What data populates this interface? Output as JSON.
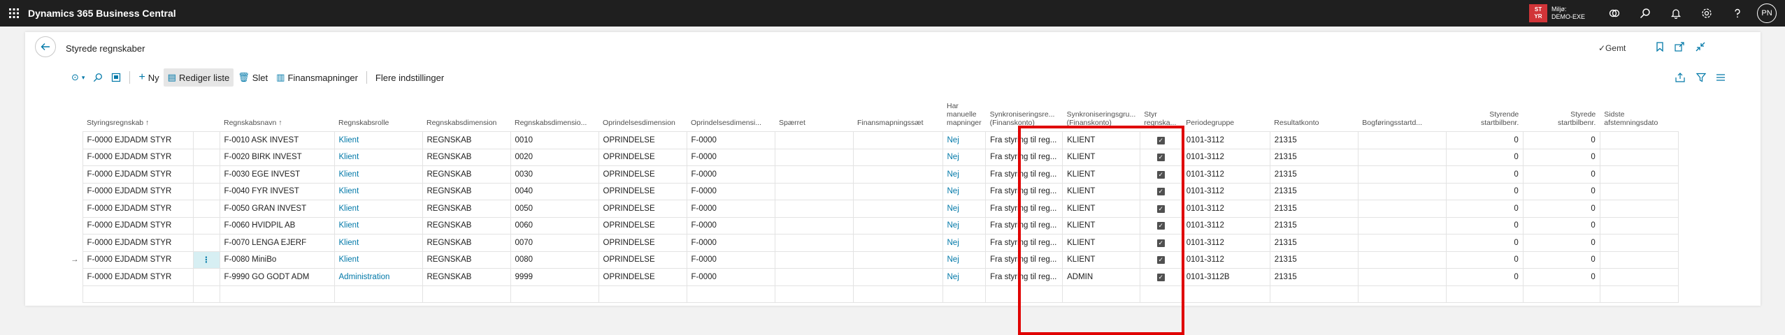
{
  "topbar": {
    "app_name": "Dynamics 365 Business Central",
    "env_badge_line1": "ST",
    "env_badge_line2": "YR",
    "env_line1": "Miljø:",
    "env_line2": "DEMO-EXE",
    "avatar": "PN",
    "icons": [
      "waffle-icon",
      "connect-icon",
      "search-icon",
      "bell-icon",
      "settings-icon",
      "help-icon"
    ]
  },
  "page": {
    "title": "Styrede regnskaber",
    "saved": "✓Gemt"
  },
  "actions": {
    "new": "Ny",
    "edit_list": "Rediger liste",
    "delete": "Slet",
    "mapping": "Finansmapninger",
    "more": "Flere indstillinger"
  },
  "columns": [
    {
      "l1": "",
      "l2": "Styringsregnskab ↑"
    },
    {
      "l1": "",
      "l2": ""
    },
    {
      "l1": "",
      "l2": "Regnskabsnavn ↑"
    },
    {
      "l1": "",
      "l2": "Regnskabsrolle"
    },
    {
      "l1": "",
      "l2": "Regnskabsdimension"
    },
    {
      "l1": "",
      "l2": "Regnskabsdimensio..."
    },
    {
      "l1": "",
      "l2": "Oprindelsesdimension"
    },
    {
      "l1": "",
      "l2": "Oprindelsesdimensi..."
    },
    {
      "l1": "",
      "l2": "Spærret"
    },
    {
      "l1": "",
      "l2": "Finansmapningssæt"
    },
    {
      "l1": "Har",
      "l2": "manuelle",
      "l3": "mapninger"
    },
    {
      "l1": "Synkroniseringsre...",
      "l2": "(Finanskonto)"
    },
    {
      "l1": "Synkroniseringsgru...",
      "l2": "(Finanskonto)"
    },
    {
      "l1": "Styr",
      "l2": "regnska..."
    },
    {
      "l1": "",
      "l2": "Periodegruppe"
    },
    {
      "l1": "",
      "l2": "Resultatkonto"
    },
    {
      "l1": "",
      "l2": "Bogføringsstartd..."
    },
    {
      "l1": "Styrende",
      "l2": "startbilbenr."
    },
    {
      "l1": "Styrede",
      "l2": "startbilbenr."
    },
    {
      "l1": "Sidste",
      "l2": "afstemningsdato"
    }
  ],
  "rows": [
    {
      "arrow": "",
      "account": "F-0000 EJDADM STYR",
      "dots": "",
      "name": "F-0010 ASK INVEST",
      "role": "Klient",
      "dim": "REGNSKAB",
      "dimval": "0010",
      "origdim": "OPRINDELSE",
      "origval": "F-0000",
      "blocked": "",
      "mapset": "",
      "manual": "Nej",
      "syncdir": "Fra styring til reg...",
      "syncgrp": "KLIENT",
      "period": "0101-3112",
      "result": "21315",
      "poststart": "",
      "ctrl_start": "0",
      "sub_start": "0",
      "last_rec": ""
    },
    {
      "arrow": "",
      "account": "F-0000 EJDADM STYR",
      "dots": "",
      "name": "F-0020 BIRK INVEST",
      "role": "Klient",
      "dim": "REGNSKAB",
      "dimval": "0020",
      "origdim": "OPRINDELSE",
      "origval": "F-0000",
      "blocked": "",
      "mapset": "",
      "manual": "Nej",
      "syncdir": "Fra styring til reg...",
      "syncgrp": "KLIENT",
      "period": "0101-3112",
      "result": "21315",
      "poststart": "",
      "ctrl_start": "0",
      "sub_start": "0",
      "last_rec": ""
    },
    {
      "arrow": "",
      "account": "F-0000 EJDADM STYR",
      "dots": "",
      "name": "F-0030 EGE INVEST",
      "role": "Klient",
      "dim": "REGNSKAB",
      "dimval": "0030",
      "origdim": "OPRINDELSE",
      "origval": "F-0000",
      "blocked": "",
      "mapset": "",
      "manual": "Nej",
      "syncdir": "Fra styring til reg...",
      "syncgrp": "KLIENT",
      "period": "0101-3112",
      "result": "21315",
      "poststart": "",
      "ctrl_start": "0",
      "sub_start": "0",
      "last_rec": ""
    },
    {
      "arrow": "",
      "account": "F-0000 EJDADM STYR",
      "dots": "",
      "name": "F-0040 FYR INVEST",
      "role": "Klient",
      "dim": "REGNSKAB",
      "dimval": "0040",
      "origdim": "OPRINDELSE",
      "origval": "F-0000",
      "blocked": "",
      "mapset": "",
      "manual": "Nej",
      "syncdir": "Fra styring til reg...",
      "syncgrp": "KLIENT",
      "period": "0101-3112",
      "result": "21315",
      "poststart": "",
      "ctrl_start": "0",
      "sub_start": "0",
      "last_rec": ""
    },
    {
      "arrow": "",
      "account": "F-0000 EJDADM STYR",
      "dots": "",
      "name": "F-0050 GRAN INVEST",
      "role": "Klient",
      "dim": "REGNSKAB",
      "dimval": "0050",
      "origdim": "OPRINDELSE",
      "origval": "F-0000",
      "blocked": "",
      "mapset": "",
      "manual": "Nej",
      "syncdir": "Fra styring til reg...",
      "syncgrp": "KLIENT",
      "period": "0101-3112",
      "result": "21315",
      "poststart": "",
      "ctrl_start": "0",
      "sub_start": "0",
      "last_rec": ""
    },
    {
      "arrow": "",
      "account": "F-0000 EJDADM STYR",
      "dots": "",
      "name": "F-0060 HVIDPIL AB",
      "role": "Klient",
      "dim": "REGNSKAB",
      "dimval": "0060",
      "origdim": "OPRINDELSE",
      "origval": "F-0000",
      "blocked": "",
      "mapset": "",
      "manual": "Nej",
      "syncdir": "Fra styring til reg...",
      "syncgrp": "KLIENT",
      "period": "0101-3112",
      "result": "21315",
      "poststart": "",
      "ctrl_start": "0",
      "sub_start": "0",
      "last_rec": ""
    },
    {
      "arrow": "",
      "account": "F-0000 EJDADM STYR",
      "dots": "",
      "name": "F-0070 LENGA EJERF",
      "role": "Klient",
      "dim": "REGNSKAB",
      "dimval": "0070",
      "origdim": "OPRINDELSE",
      "origval": "F-0000",
      "blocked": "",
      "mapset": "",
      "manual": "Nej",
      "syncdir": "Fra styring til reg...",
      "syncgrp": "KLIENT",
      "period": "0101-3112",
      "result": "21315",
      "poststart": "",
      "ctrl_start": "0",
      "sub_start": "0",
      "last_rec": ""
    },
    {
      "arrow": "→",
      "account": "F-0000 EJDADM STYR",
      "dots": "⋮",
      "name": "F-0080 MiniBo",
      "role": "Klient",
      "dim": "REGNSKAB",
      "dimval": "0080",
      "origdim": "OPRINDELSE",
      "origval": "F-0000",
      "blocked": "",
      "mapset": "",
      "manual": "Nej",
      "syncdir": "Fra styring til reg...",
      "syncgrp": "KLIENT",
      "period": "0101-3112",
      "result": "21315",
      "poststart": "",
      "ctrl_start": "0",
      "sub_start": "0",
      "last_rec": ""
    },
    {
      "arrow": "",
      "account": "F-0000 EJDADM STYR",
      "dots": "",
      "name": "F-9990 GO GODT ADM",
      "role": "Administration",
      "dim": "REGNSKAB",
      "dimval": "9999",
      "origdim": "OPRINDELSE",
      "origval": "F-0000",
      "blocked": "",
      "mapset": "",
      "manual": "Nej",
      "syncdir": "Fra styring til reg...",
      "syncgrp": "ADMIN",
      "period": "0101-3112B",
      "result": "21315",
      "poststart": "",
      "ctrl_start": "0",
      "sub_start": "0",
      "last_rec": ""
    },
    {
      "arrow": "",
      "account": "",
      "dots": "",
      "name": "",
      "role": "",
      "dim": "",
      "dimval": "",
      "origdim": "",
      "origval": "",
      "blocked": "",
      "mapset": "",
      "manual": "",
      "syncdir": "",
      "syncgrp": "",
      "period": "",
      "result": "",
      "poststart": "",
      "ctrl_start": "",
      "sub_start": "",
      "last_rec": ""
    }
  ],
  "controlled_checked": [
    true,
    true,
    true,
    true,
    true,
    true,
    true,
    true,
    true,
    false
  ],
  "colors": {
    "accent": "#0078a8",
    "highlight": "#e00000",
    "topbar": "#1f1f1f",
    "env_badge": "#d13438"
  }
}
